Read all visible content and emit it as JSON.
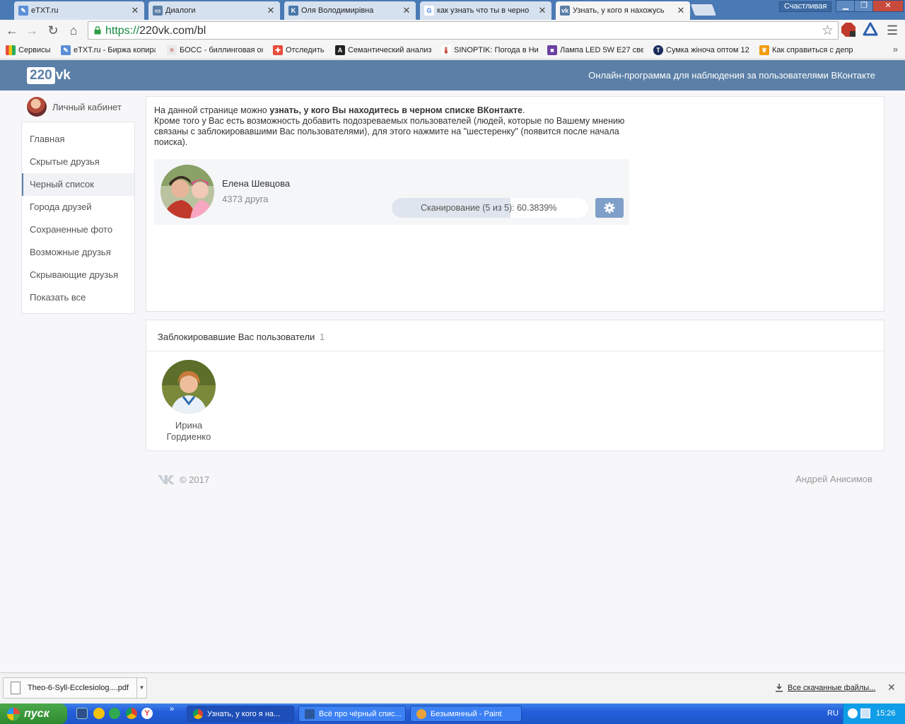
{
  "browser": {
    "tabs": [
      {
        "title": "eTXT.ru",
        "icon": "etxt-favicon-icon",
        "color": "#5b8ed6"
      },
      {
        "title": "Диалоги",
        "icon": "chat-favicon-icon",
        "color": "#5b7fa6"
      },
      {
        "title": "Оля Володимирівна",
        "icon": "vk-favicon-icon",
        "color": "#4a76a8"
      },
      {
        "title": "как узнать что ты в черно",
        "icon": "google-favicon-icon",
        "color": "#4285f4"
      },
      {
        "title": "Узнать, у кого я нахожусь",
        "icon": "220vk-favicon-icon",
        "color": "#5b7fa6"
      }
    ],
    "profile": "Счастливая",
    "url_scheme": "https://",
    "url_rest": "220vk.com/bl",
    "bookmarks": [
      {
        "label": "Сервисы",
        "icon": "apps-grid-icon"
      },
      {
        "label": "eTXT.ru - Биржа копира",
        "icon": "etxt-icon"
      },
      {
        "label": "БОСС - биллинговая он",
        "icon": "boss-icon"
      },
      {
        "label": "Отследить",
        "icon": "track-icon"
      },
      {
        "label": "Семантический анализ",
        "icon": "a-letter-icon"
      },
      {
        "label": "SINOPTIK: Погода в Ни",
        "icon": "thermometer-icon"
      },
      {
        "label": "Лампа LED 5W E27 свет",
        "icon": "square-icon"
      },
      {
        "label": "Сумка жіноча оптом 12",
        "icon": "t-letter-icon"
      },
      {
        "label": "Как справиться с депр",
        "icon": "bird-icon"
      }
    ]
  },
  "site": {
    "logo_num": "220",
    "logo_suffix": "vk",
    "tagline": "Онлайн-программа для наблюдения за пользователями ВКонтакте",
    "cabinet_label": "Личный кабинет",
    "menu": [
      {
        "label": "Главная",
        "active": false
      },
      {
        "label": "Скрытые друзья",
        "active": false
      },
      {
        "label": "Черный список",
        "active": true
      },
      {
        "label": "Города друзей",
        "active": false
      },
      {
        "label": "Сохраненные фото",
        "active": false
      },
      {
        "label": "Возможные друзья",
        "active": false
      },
      {
        "label": "Скрывающие друзья",
        "active": false
      },
      {
        "label": "Показать все",
        "active": false
      }
    ],
    "intro": {
      "line1_pre": "На данной странице можно ",
      "line1_bold": "узнать, у кого Вы находитесь в черном списке ВКонтакте",
      "line1_post": ".",
      "line2": "Кроме того у Вас есть возможность добавить подозреваемых пользователей (людей, которые по Вашему мнению связаны с заблокировавшими Вас пользователями), для этого нажмите на \"шестеренку\" (появится после начала поиска)."
    },
    "user": {
      "name": "Елена Шевцова",
      "friends": "4373 друга",
      "scan_text": "Сканирование (5 из 5): 60.3839%",
      "scan_progress": 0.6038
    },
    "blocked": {
      "title": "Заблокировавшие Вас пользователи",
      "count": "1",
      "users": [
        {
          "first": "Ирина",
          "last": "Гордиенко"
        }
      ]
    },
    "footer": {
      "copyright": "© 2017",
      "author": "Андрей Анисимов"
    }
  },
  "downloads": {
    "file": "Theo-6-Syll-Ecclesiolog....pdf",
    "all_label": "Все скачанные файлы..."
  },
  "taskbar": {
    "start": "пуск",
    "tasks": [
      {
        "label": "Узнать, у кого я на...",
        "active": true
      },
      {
        "label": "Всё про чёрный спис...",
        "active": false
      },
      {
        "label": "Безымянный - Paint",
        "active": false
      }
    ],
    "lang": "RU",
    "time": "15:26"
  },
  "colors": {
    "header": "#5b7fa6",
    "accent": "#7f9fc8",
    "tabbar": "#4a7ab5"
  }
}
